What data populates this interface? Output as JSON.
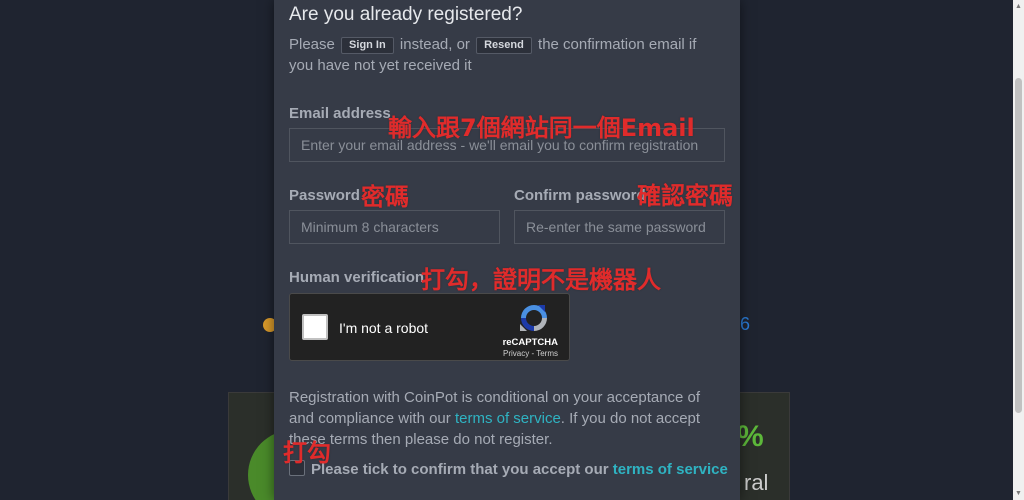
{
  "background": {
    "number_fragment": "6",
    "banner_text_top": "%",
    "banner_text_bottom": "ral"
  },
  "modal": {
    "title": "Are you already registered?",
    "intro": {
      "please": "Please",
      "sign_in_label": "Sign In",
      "instead_or": "instead, or",
      "resend_label": "Resend",
      "rest": "the confirmation email if you have not yet received it"
    },
    "email": {
      "label": "Email address",
      "placeholder": "Enter your email address - we'll email you to confirm registration"
    },
    "password": {
      "label": "Password",
      "placeholder": "Minimum 8 characters"
    },
    "confirm_password": {
      "label": "Confirm password",
      "placeholder": "Re-enter the same password"
    },
    "human_verification": {
      "label": "Human verification"
    },
    "captcha": {
      "checkbox_label": "I'm not a robot",
      "brand": "reCAPTCHA",
      "privacy": "Privacy",
      "separator": "-",
      "terms": "Terms"
    },
    "terms": {
      "text_1": "Registration with CoinPot is conditional on your acceptance of and compliance with our",
      "link_1": "terms of service",
      "text_2": ". If you do not accept these terms then please do not register."
    },
    "tick": {
      "text": "Please tick to confirm that you accept our",
      "link": "terms of service"
    }
  },
  "annotations": {
    "email_note": "輸入跟7個網站同一個Email",
    "password_note": "密碼",
    "confirm_note": "確認密碼",
    "verification_note": "打勾，證明不是機器人",
    "tick_note": "打勾"
  },
  "colors": {
    "page_bg": "#1f2430",
    "modal_bg": "#363b47",
    "link": "#2fb3c2",
    "annotation_red": "#e02b2b"
  }
}
